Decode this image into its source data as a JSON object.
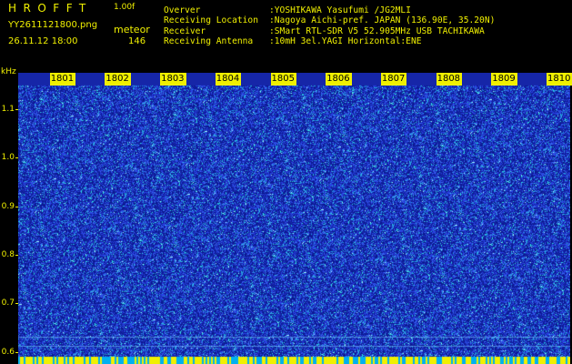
{
  "header": {
    "app_title": "HROFFT",
    "app_version": "1.00f",
    "file_name": "YY2611121800.png",
    "detect_label": "meteor",
    "date_time": "26.11.12 18:00",
    "meteor_count": "146"
  },
  "station": [
    {
      "key": "Overver",
      "value": ":YOSHIKAWA Yasufumi /JG2MLI"
    },
    {
      "key": "Receiving Location",
      "value": ":Nagoya Aichi-pref. JAPAN (136.90E, 35.20N)"
    },
    {
      "key": "Receiver",
      "value": ":SMart RTL-SDR V5 52.905MHz USB TACHIKAWA"
    },
    {
      "key": "Receiving Antenna",
      "value": ":10mH 3el.YAGI Horizontal:ENE"
    }
  ],
  "chart_data": {
    "type": "heatmap",
    "title": "",
    "ylabel": "kHz",
    "x_ticks": [
      "1801",
      "1802",
      "1803",
      "1804",
      "1805",
      "1806",
      "1807",
      "1808",
      "1809",
      "1810"
    ],
    "y_ticks": [
      "1.1",
      "1.0",
      "0.9",
      "0.8",
      "0.7",
      "0.6"
    ],
    "y_tick_values": [
      1.1,
      1.0,
      0.9,
      0.8,
      0.7,
      0.6
    ],
    "x_range": [
      1800,
      1810
    ],
    "y_range": [
      0.575,
      1.175
    ],
    "colors": {
      "background": "#1626a8",
      "noise": [
        "#0a1890",
        "#2740e0",
        "#3a6cf0",
        "#20a8e0",
        "#30e0e0",
        "#a0ffff"
      ],
      "bottom_band": [
        "#f0f000",
        "#00b0f0"
      ],
      "axis": "#f0f000"
    }
  }
}
